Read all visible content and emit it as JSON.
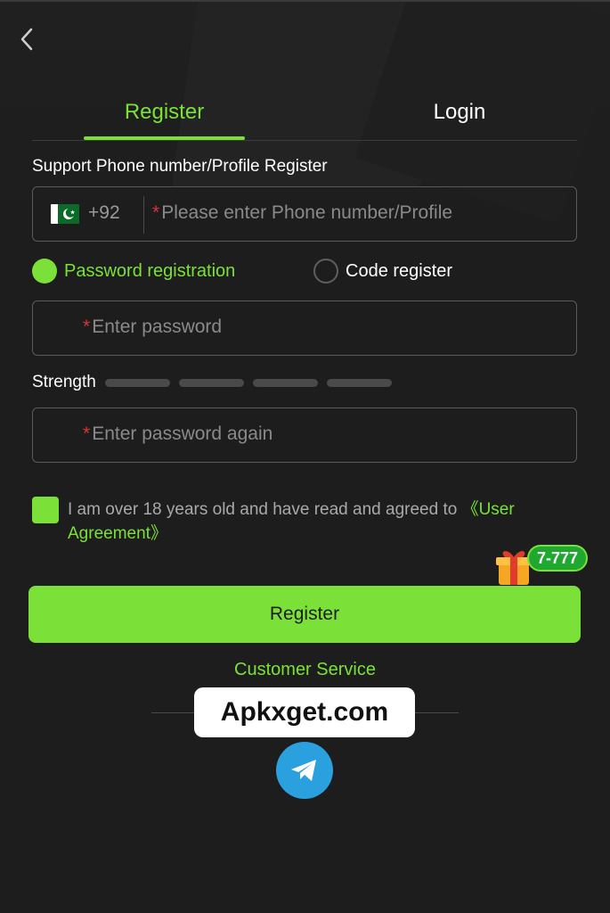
{
  "header": {
    "tabs": [
      {
        "label": "Register",
        "active": true
      },
      {
        "label": "Login",
        "active": false
      }
    ]
  },
  "phone": {
    "section_label": "Support Phone number/Profile Register",
    "country_code": "+92",
    "required_mark": "*",
    "placeholder": "Please enter Phone number/Profile"
  },
  "mode": {
    "options": [
      {
        "label": "Password registration",
        "selected": true
      },
      {
        "label": "Code register",
        "selected": false
      }
    ]
  },
  "password": {
    "required_mark": "*",
    "placeholder": "Enter password"
  },
  "strength": {
    "label": "Strength",
    "level": 0,
    "bars": 4
  },
  "confirm": {
    "required_mark": "*",
    "placeholder": "Enter password again"
  },
  "agreement": {
    "checked": true,
    "text": "I am over 18 years old and have read and agreed to ",
    "link_part1": "《User",
    "link_part2": "Agreement》"
  },
  "promo": {
    "badge": "7-777",
    "icon": "gift-icon"
  },
  "actions": {
    "register_label": "Register",
    "customer_service": "Customer Service"
  },
  "watermark": {
    "text": "Apkxget.com"
  },
  "social": {
    "icon": "telegram-icon"
  },
  "colors": {
    "accent": "#7be138",
    "background": "#1d1d1d",
    "telegram": "#2aa0de",
    "required": "#d9343a"
  }
}
